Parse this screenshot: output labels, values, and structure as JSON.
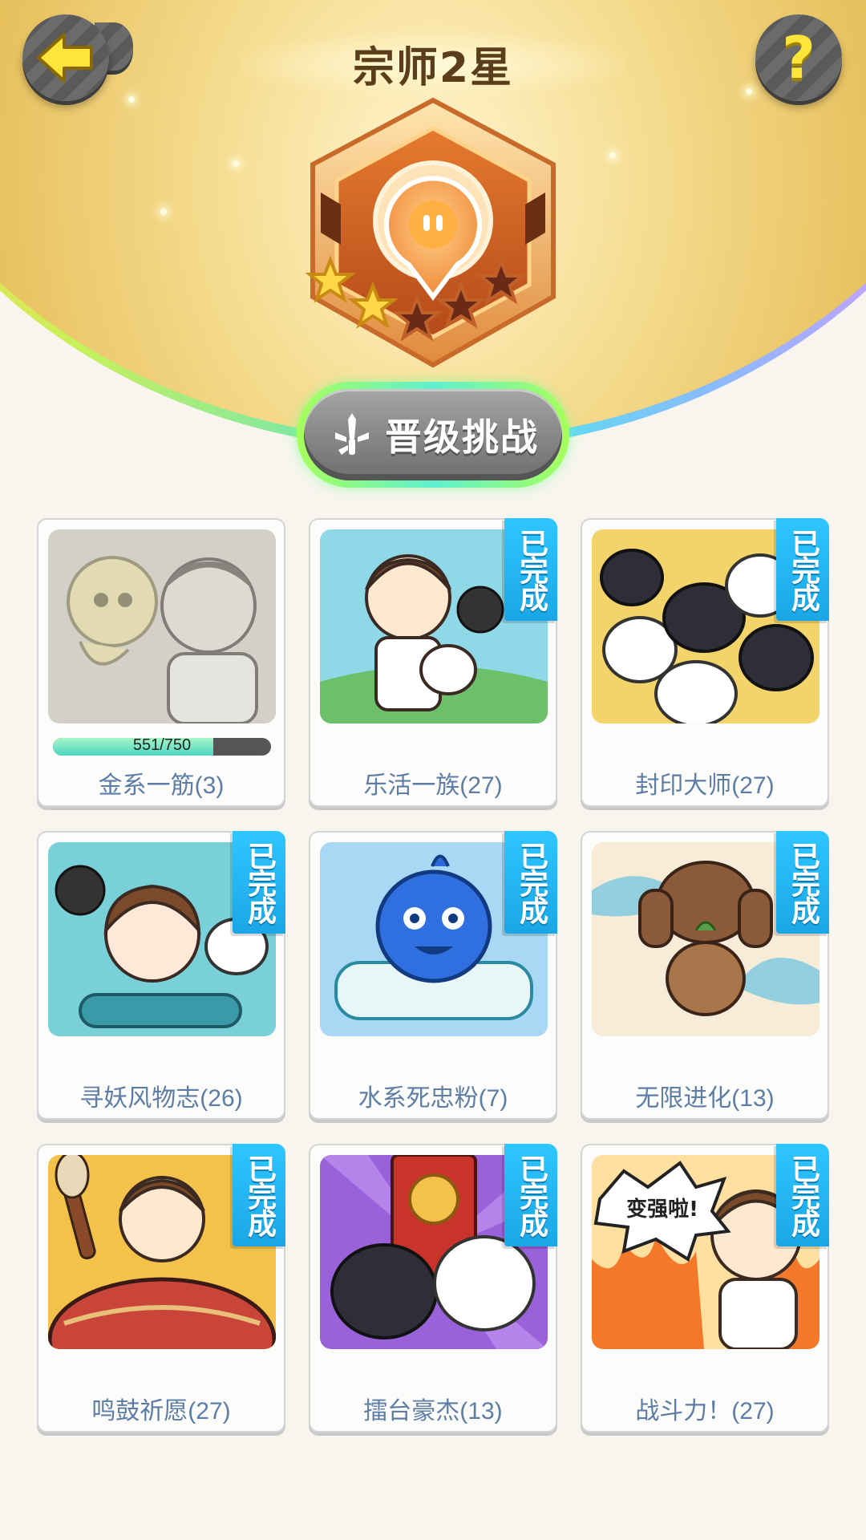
{
  "header": {
    "title": "宗师2星",
    "back_icon": "back-arrow-icon",
    "help_label": "?",
    "badge": {
      "rank_stars_filled": 2,
      "rank_stars_total": 5
    }
  },
  "promote": {
    "label": "晋级挑战",
    "icon": "sword-icon"
  },
  "completed_tag": "已完成",
  "achievements": [
    {
      "label": "金系一筋(3)",
      "completed": false,
      "progress_text": "551/750",
      "progress": 0.7347,
      "theme": "gold-ghost"
    },
    {
      "label": "乐活一族(27)",
      "completed": true,
      "theme": "boy-play"
    },
    {
      "label": "封印大师(27)",
      "completed": true,
      "theme": "many-monsters"
    },
    {
      "label": "寻妖风物志(26)",
      "completed": true,
      "theme": "girl-book"
    },
    {
      "label": "水系死忠粉(7)",
      "completed": true,
      "theme": "water-monster"
    },
    {
      "label": "无限进化(13)",
      "completed": true,
      "theme": "evolution"
    },
    {
      "label": "鸣鼓祈愿(27)",
      "completed": true,
      "theme": "drum"
    },
    {
      "label": "擂台豪杰(13)",
      "completed": true,
      "theme": "arena"
    },
    {
      "label": "战斗力！(27)",
      "completed": true,
      "theme": "stronger",
      "image_text": "变强啦!"
    }
  ],
  "colors": {
    "ribbon": "#1aa6e6",
    "label": "#5d7da6",
    "promote_border": "#7ff0a0"
  }
}
